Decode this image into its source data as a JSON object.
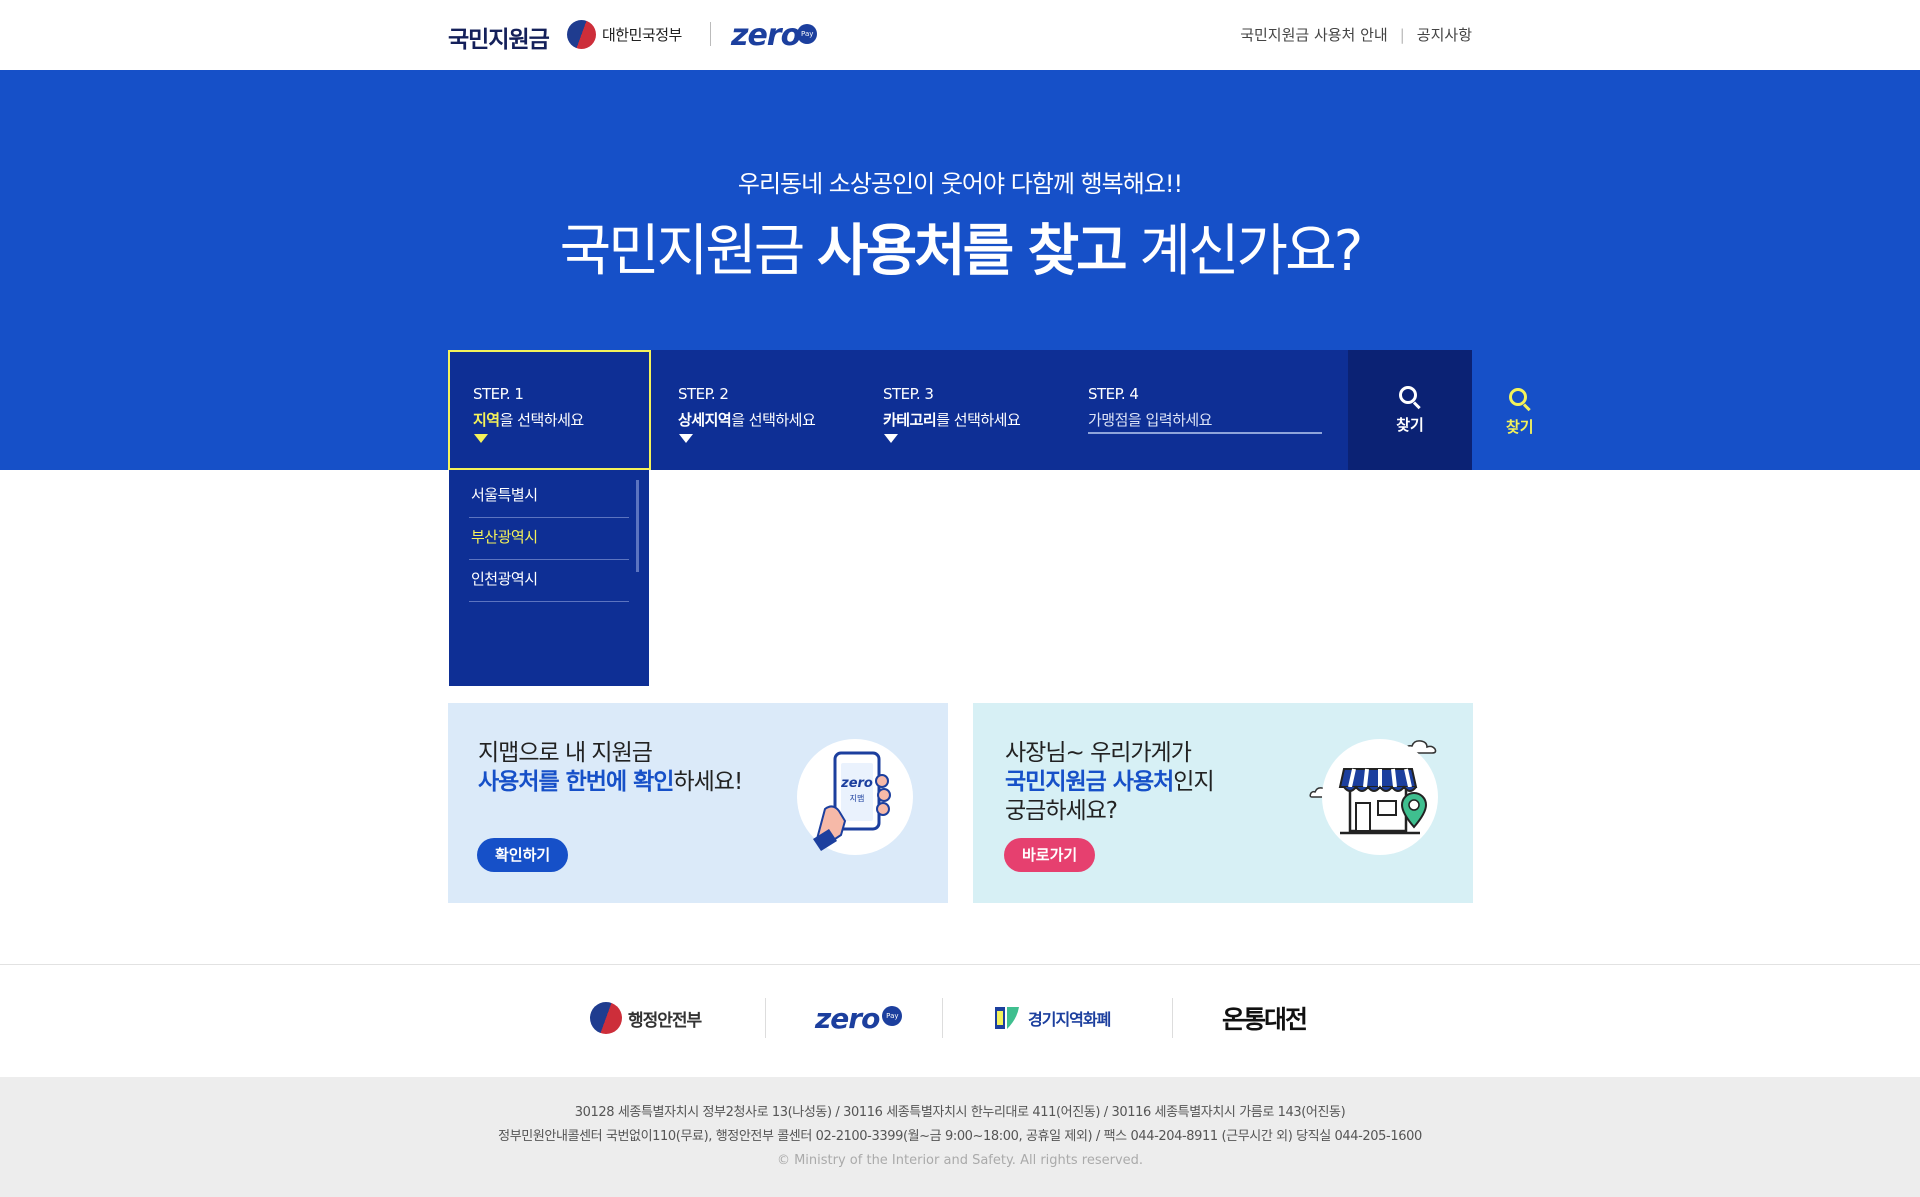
{
  "header": {
    "logo": "국민지원금",
    "gov_label": "대한민국정부",
    "zero_brand": "zero",
    "zero_pay_badge": "Pay",
    "nav": [
      "국민지원금 사용처 안내",
      "공지사항"
    ]
  },
  "hero": {
    "subtitle": "우리동네 소상공인이 웃어야 다함께 행복해요!!",
    "title_part1": "국민지원금 ",
    "title_bold": "사용처를 찾고",
    "title_part2": " 계신가요?"
  },
  "search": {
    "steps": [
      {
        "label": "STEP. 1",
        "highlight": "지역",
        "rest": "을 선택하세요"
      },
      {
        "label": "STEP. 2",
        "highlight": "상세지역",
        "rest": "을 선택하세요"
      },
      {
        "label": "STEP. 3",
        "highlight": "카테고리",
        "rest": "를 선택하세요"
      },
      {
        "label": "STEP. 4",
        "placeholder": "가맹점을 입력하세요"
      }
    ],
    "button_label": "찾기",
    "button_label_alt": "찾기"
  },
  "dropdown": {
    "items": [
      "서울특별시",
      "부산광역시",
      "인천광역시"
    ],
    "active_index": 1
  },
  "banners": [
    {
      "line1": "지맵으로 내 지원금",
      "line2_blue": "사용처를 한번에 확인",
      "line2_rest": "하세요!",
      "button": "확인하기",
      "phone_text": "zero",
      "phone_sub": "지맵"
    },
    {
      "line1": "사장님~ 우리가게가",
      "line2_blue": "국민지원금 사용처",
      "line2_rest": "인지",
      "line3": "궁금하세요?",
      "button": "바로가기"
    }
  ],
  "footer": {
    "partners": [
      "행정안전부",
      "zero",
      "경기지역화폐",
      "온통대전"
    ],
    "address_line1": "30128 세종특별자치시 정부2청사로 13(나성동) / 30116 세종특별자치시 한누리대로 411(어진동) / 30116 세종특별자치시 가름로 143(어진동)",
    "address_line2": "정부민원안내콜센터 국번없이110(무료), 행정안전부 콜센터 02-2100-3399(월~금 9:00~18:00, 공휴일 제외) / 팩스 044-204-8911 (근무시간 외) 당직실 044-205-1600",
    "copyright": "© Ministry of the Interior and Safety. All rights reserved."
  },
  "colors": {
    "primary": "#1650c8",
    "dark_navy": "#0e2f95",
    "highlight_yellow": "#f4f25a",
    "pink": "#e6406f"
  }
}
